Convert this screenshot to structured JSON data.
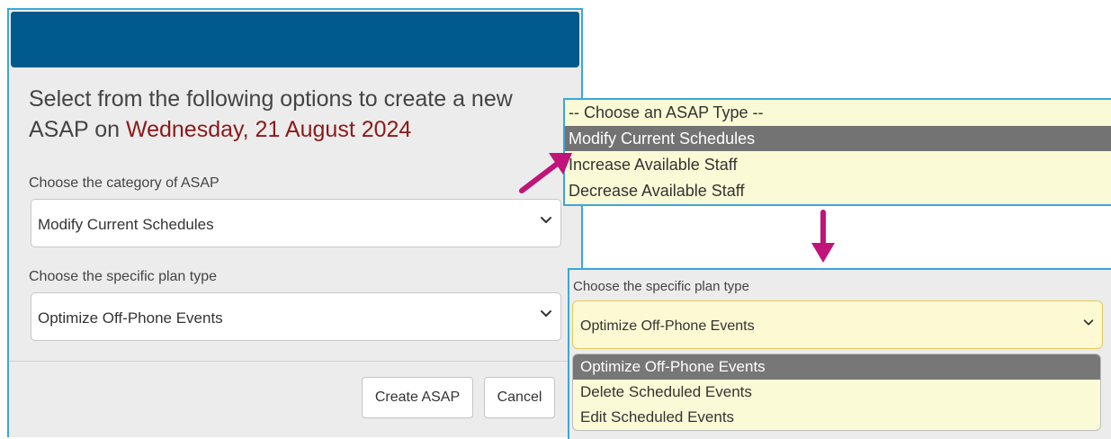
{
  "modal": {
    "title_prefix": "Select from the following options to create a new ASAP on ",
    "title_date": "Wednesday, 21 August 2024",
    "category_label": "Choose the category of ASAP",
    "category_value": "Modify Current Schedules",
    "plan_label": "Choose the specific plan type",
    "plan_value": "Optimize Off-Phone Events",
    "create_button": "Create ASAP",
    "cancel_button": "Cancel"
  },
  "popup_asap_type": {
    "options": [
      {
        "label": "-- Choose an ASAP Type --"
      },
      {
        "label": "Modify Current Schedules",
        "selected": true
      },
      {
        "label": "Increase Available Staff"
      },
      {
        "label": "Decrease Available Staff"
      }
    ]
  },
  "plan_zoom": {
    "label": "Choose the specific plan type",
    "value": "Optimize Off-Phone Events",
    "options": [
      {
        "label": "Optimize Off-Phone Events",
        "selected": true
      },
      {
        "label": "Delete Scheduled Events"
      },
      {
        "label": "Edit Scheduled Events"
      }
    ]
  },
  "colors": {
    "header": "#005a8b",
    "date_text": "#8b1a1a",
    "popup_bg": "#fbfad6",
    "selected_option": "#737373",
    "accent_border": "#3aa8d8",
    "arrow": "#c0147a"
  },
  "icons": [
    "chevron-down-icon",
    "pointer-arrow-icon",
    "down-arrow-icon"
  ]
}
